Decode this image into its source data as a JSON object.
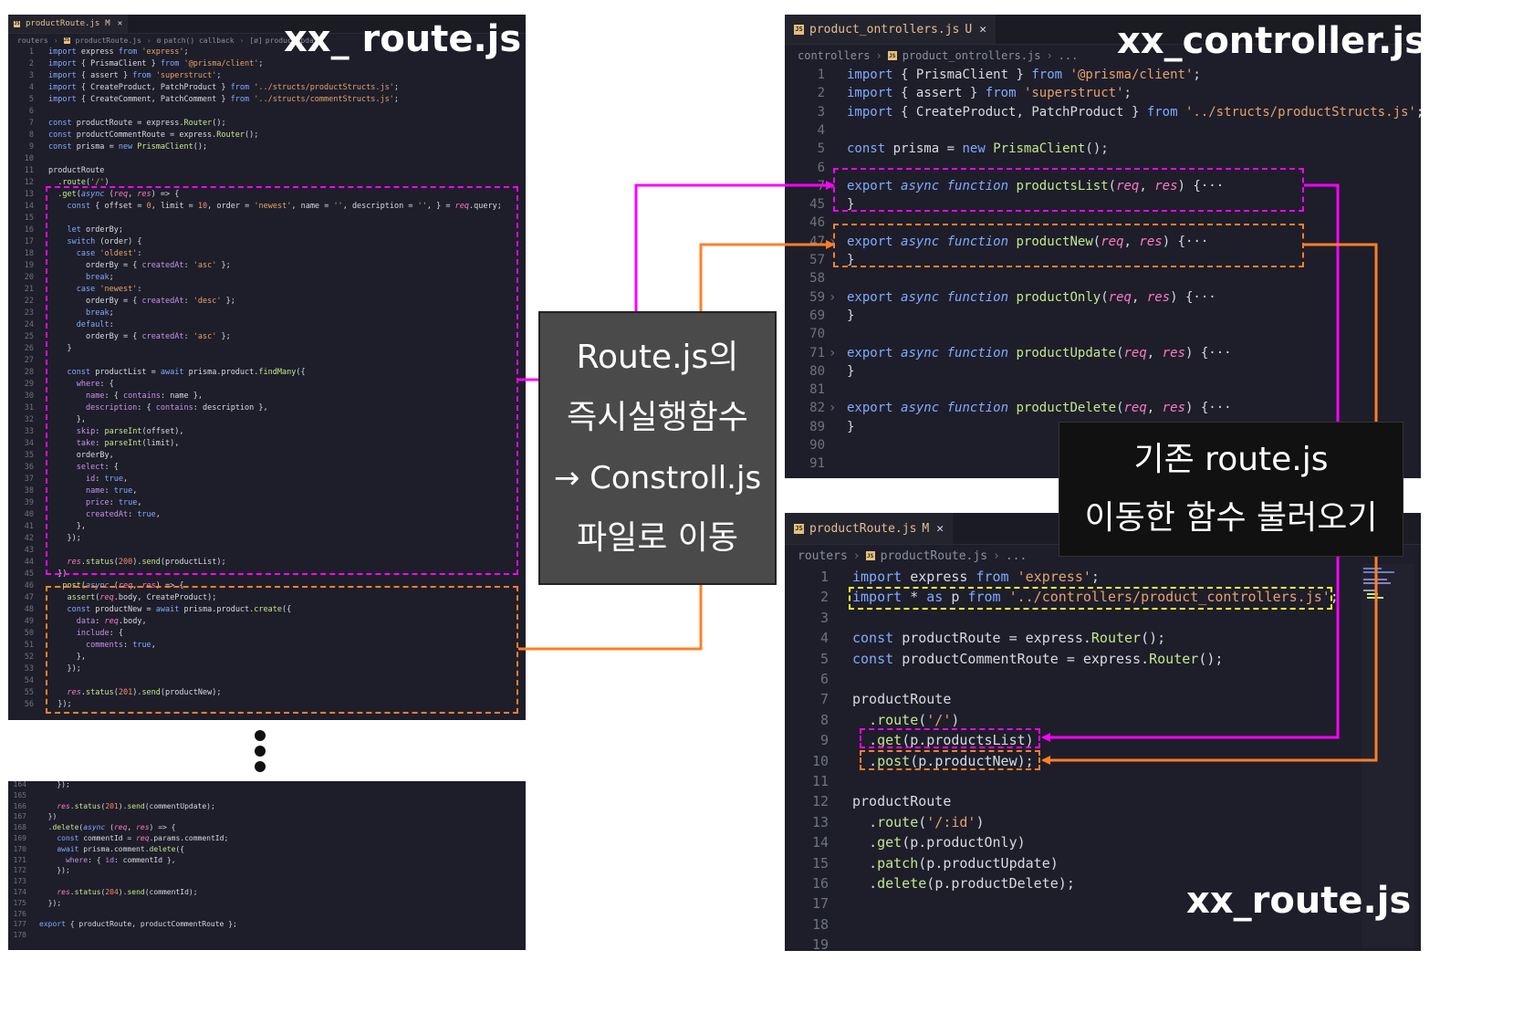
{
  "colors": {
    "magenta": "#ff00ff",
    "orange": "#ff7f27",
    "yellow": "#ffff33",
    "editor_bg": "#1e1e2a"
  },
  "left_panel": {
    "tab": {
      "label": "productRoute.js",
      "status": "M"
    },
    "breadcrumb": [
      "routers",
      "productRoute.js",
      "patch() callback",
      "productUpdate"
    ],
    "heading": "xx_ route.js",
    "lines": [
      {
        "n": "1",
        "t": "import express from 'express';"
      },
      {
        "n": "2",
        "t": "import { PrismaClient } from '@prisma/client';"
      },
      {
        "n": "3",
        "t": "import { assert } from 'superstruct';"
      },
      {
        "n": "4",
        "t": "import { CreateProduct, PatchProduct } from '../structs/productStructs.js';"
      },
      {
        "n": "5",
        "t": "import { CreateComment, PatchComment } from '../structs/commentStructs.js';"
      },
      {
        "n": "6",
        "t": ""
      },
      {
        "n": "7",
        "t": "const productRoute = express.Router();"
      },
      {
        "n": "8",
        "t": "const productCommentRoute = express.Router();"
      },
      {
        "n": "9",
        "t": "const prisma = new PrismaClient();"
      },
      {
        "n": "10",
        "t": ""
      },
      {
        "n": "11",
        "t": "productRoute"
      },
      {
        "n": "12",
        "t": "  .route('/')"
      },
      {
        "n": "13",
        "t": "  .get(async (req, res) => {"
      },
      {
        "n": "14",
        "t": "    const { offset = 0, limit = 10, order = 'newest', name = '', description = '', } = req.query;"
      },
      {
        "n": "15",
        "t": ""
      },
      {
        "n": "16",
        "t": "    let orderBy;"
      },
      {
        "n": "17",
        "t": "    switch (order) {"
      },
      {
        "n": "18",
        "t": "      case 'oldest':"
      },
      {
        "n": "19",
        "t": "        orderBy = { createdAt: 'asc' };"
      },
      {
        "n": "20",
        "t": "        break;"
      },
      {
        "n": "21",
        "t": "      case 'newest':"
      },
      {
        "n": "22",
        "t": "        orderBy = { createdAt: 'desc' };"
      },
      {
        "n": "23",
        "t": "        break;"
      },
      {
        "n": "24",
        "t": "      default:"
      },
      {
        "n": "25",
        "t": "        orderBy = { createdAt: 'asc' };"
      },
      {
        "n": "26",
        "t": "    }"
      },
      {
        "n": "27",
        "t": ""
      },
      {
        "n": "28",
        "t": "    const productList = await prisma.product.findMany({"
      },
      {
        "n": "29",
        "t": "      where: {"
      },
      {
        "n": "30",
        "t": "        name: { contains: name },"
      },
      {
        "n": "31",
        "t": "        description: { contains: description },"
      },
      {
        "n": "32",
        "t": "      },"
      },
      {
        "n": "33",
        "t": "      skip: parseInt(offset),"
      },
      {
        "n": "34",
        "t": "      take: parseInt(limit),"
      },
      {
        "n": "35",
        "t": "      orderBy,"
      },
      {
        "n": "36",
        "t": "      select: {"
      },
      {
        "n": "37",
        "t": "        id: true,"
      },
      {
        "n": "38",
        "t": "        name: true,"
      },
      {
        "n": "39",
        "t": "        price: true,"
      },
      {
        "n": "40",
        "t": "        createdAt: true,"
      },
      {
        "n": "41",
        "t": "      },"
      },
      {
        "n": "42",
        "t": "    });"
      },
      {
        "n": "43",
        "t": ""
      },
      {
        "n": "44",
        "t": "    res.status(200).send(productList);"
      },
      {
        "n": "45",
        "t": "  })"
      },
      {
        "n": "46",
        "t": "  .post(async (req, res) => {"
      },
      {
        "n": "47",
        "t": "    assert(req.body, CreateProduct);"
      },
      {
        "n": "48",
        "t": "    const productNew = await prisma.product.create({"
      },
      {
        "n": "49",
        "t": "      data: req.body,"
      },
      {
        "n": "50",
        "t": "      include: {"
      },
      {
        "n": "51",
        "t": "        comments: true,"
      },
      {
        "n": "52",
        "t": "      },"
      },
      {
        "n": "53",
        "t": "    });"
      },
      {
        "n": "54",
        "t": ""
      },
      {
        "n": "55",
        "t": "    res.status(201).send(productNew);"
      },
      {
        "n": "56",
        "t": "  });"
      }
    ]
  },
  "left_bottom_panel": {
    "lines": [
      {
        "n": "164",
        "t": "    });"
      },
      {
        "n": "165",
        "t": ""
      },
      {
        "n": "166",
        "t": "    res.status(201).send(commentUpdate);"
      },
      {
        "n": "167",
        "t": "  })"
      },
      {
        "n": "168",
        "t": "  .delete(async (req, res) => {"
      },
      {
        "n": "169",
        "t": "    const commentId = req.params.commentId;"
      },
      {
        "n": "170",
        "t": "    await prisma.comment.delete({"
      },
      {
        "n": "171",
        "t": "      where: { id: commentId },"
      },
      {
        "n": "172",
        "t": "    });"
      },
      {
        "n": "173",
        "t": ""
      },
      {
        "n": "174",
        "t": "    res.status(204).send(commentId);"
      },
      {
        "n": "175",
        "t": "  });"
      },
      {
        "n": "176",
        "t": ""
      },
      {
        "n": "177",
        "t": "export { productRoute, productCommentRoute };"
      },
      {
        "n": "178",
        "t": ""
      }
    ]
  },
  "controller_panel": {
    "tab": {
      "label": "product_ontrollers.js",
      "status": "U"
    },
    "breadcrumb": [
      "controllers",
      "product_ontrollers.js",
      "..."
    ],
    "heading": "xx_controller.js",
    "lines": [
      {
        "n": "1",
        "t": "import { PrismaClient } from '@prisma/client';"
      },
      {
        "n": "2",
        "t": "import { assert } from 'superstruct';"
      },
      {
        "n": "3",
        "t": "import { CreateProduct, PatchProduct } from '../structs/productStructs.js';"
      },
      {
        "n": "4",
        "t": ""
      },
      {
        "n": "5",
        "t": "const prisma = new PrismaClient();"
      },
      {
        "n": "6",
        "t": ""
      },
      {
        "n": "7",
        "t": "export async function productsList(req, res) {···",
        "fold": true
      },
      {
        "n": "45",
        "t": "}"
      },
      {
        "n": "46",
        "t": ""
      },
      {
        "n": "47",
        "t": "export async function productNew(req, res) {···",
        "fold": true
      },
      {
        "n": "57",
        "t": "}"
      },
      {
        "n": "58",
        "t": ""
      },
      {
        "n": "59",
        "t": "export async function productOnly(req, res) {···",
        "fold": true
      },
      {
        "n": "69",
        "t": "}"
      },
      {
        "n": "70",
        "t": ""
      },
      {
        "n": "71",
        "t": "export async function productUpdate(req, res) {···",
        "fold": true
      },
      {
        "n": "80",
        "t": "}"
      },
      {
        "n": "81",
        "t": ""
      },
      {
        "n": "82",
        "t": "export async function productDelete(req, res) {···",
        "fold": true
      },
      {
        "n": "89",
        "t": "}"
      },
      {
        "n": "90",
        "t": ""
      },
      {
        "n": "91",
        "t": ""
      }
    ]
  },
  "new_route_panel": {
    "tab": {
      "label": "productRoute.js",
      "status": "M"
    },
    "breadcrumb": [
      "routers",
      "productRoute.js",
      "..."
    ],
    "heading": "xx_route.js",
    "lines": [
      {
        "n": "1",
        "t": "import express from 'express';"
      },
      {
        "n": "2",
        "t": "import * as p from '../controllers/product_controllers.js';"
      },
      {
        "n": "3",
        "t": ""
      },
      {
        "n": "4",
        "t": "const productRoute = express.Router();"
      },
      {
        "n": "5",
        "t": "const productCommentRoute = express.Router();"
      },
      {
        "n": "6",
        "t": ""
      },
      {
        "n": "7",
        "t": "productRoute"
      },
      {
        "n": "8",
        "t": "  .route('/')"
      },
      {
        "n": "9",
        "t": "  .get(p.productsList)"
      },
      {
        "n": "10",
        "t": "  .post(p.productNew);"
      },
      {
        "n": "11",
        "t": ""
      },
      {
        "n": "12",
        "t": "productRoute"
      },
      {
        "n": "13",
        "t": "  .route('/:id')"
      },
      {
        "n": "14",
        "t": "  .get(p.productOnly)"
      },
      {
        "n": "15",
        "t": "  .patch(p.productUpdate)"
      },
      {
        "n": "16",
        "t": "  .delete(p.productDelete);"
      },
      {
        "n": "17",
        "t": ""
      },
      {
        "n": "18",
        "t": ""
      },
      {
        "n": "19",
        "t": ""
      }
    ]
  },
  "callout_move": {
    "lines": [
      "Route.js의",
      "즉시실행함수",
      "→ Constroll.js",
      "파일로 이동"
    ]
  },
  "callout_import": {
    "lines": [
      "기존 route.js",
      "이동한 함수 불러오기"
    ]
  }
}
